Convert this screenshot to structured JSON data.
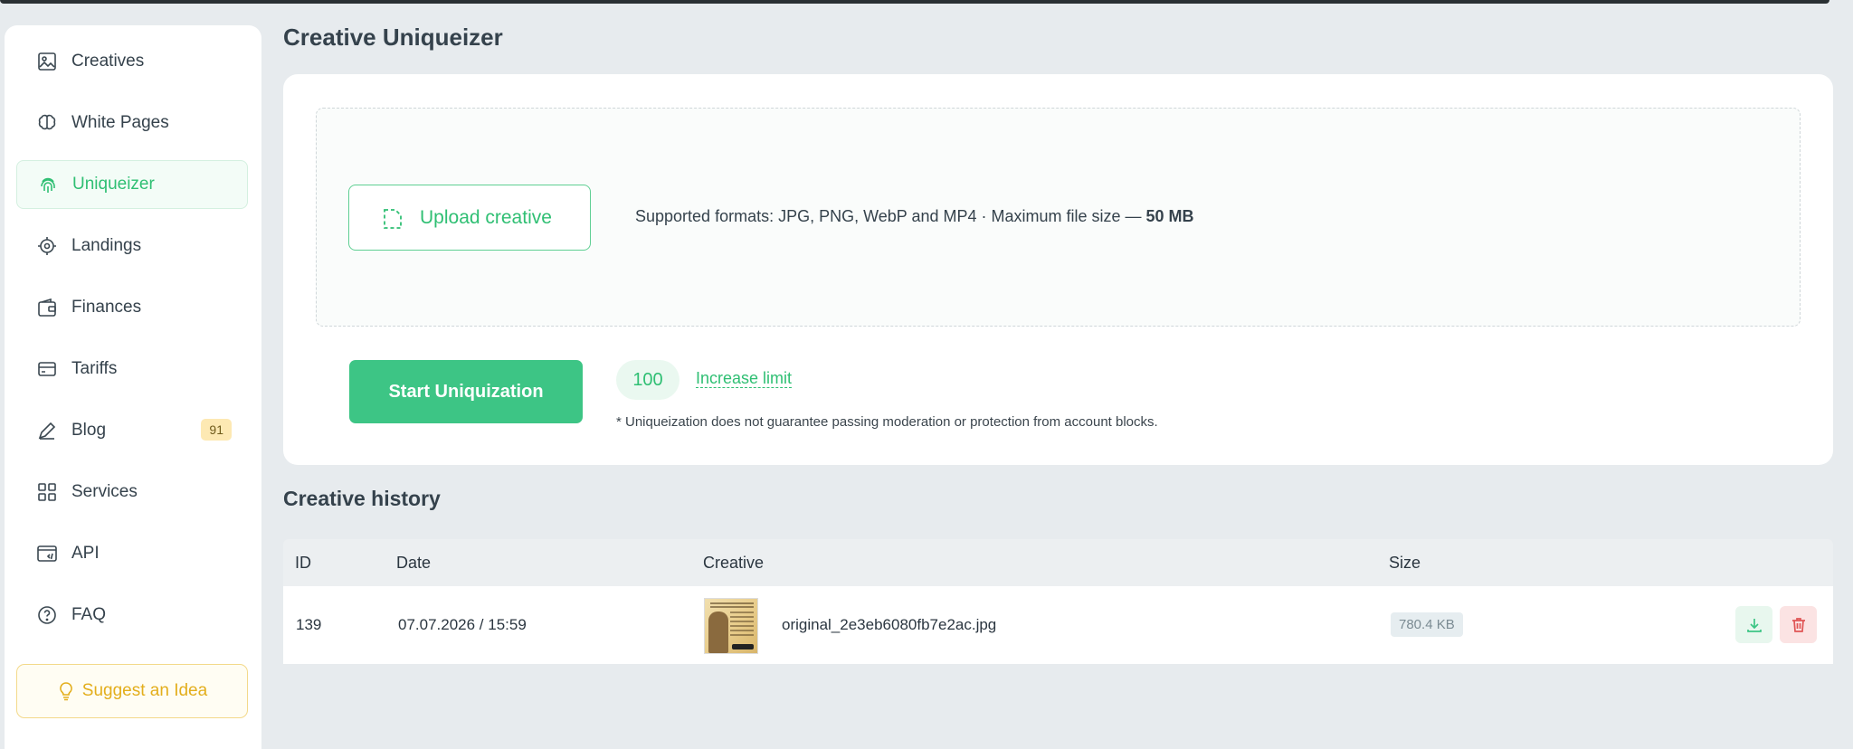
{
  "sidebar": {
    "items": [
      {
        "label": "Creatives",
        "icon": "image-icon"
      },
      {
        "label": "White Pages",
        "icon": "brain-icon"
      },
      {
        "label": "Uniqueizer",
        "icon": "fingerprint-icon"
      },
      {
        "label": "Landings",
        "icon": "target-icon"
      },
      {
        "label": "Finances",
        "icon": "wallet-icon"
      },
      {
        "label": "Tariffs",
        "icon": "card-icon"
      },
      {
        "label": "Blog",
        "icon": "pen-icon",
        "badge": "91"
      },
      {
        "label": "Services",
        "icon": "grid-icon"
      },
      {
        "label": "API",
        "icon": "code-window-icon"
      },
      {
        "label": "FAQ",
        "icon": "question-icon"
      }
    ],
    "active": "Uniqueizer",
    "suggest_label": "Suggest an Idea"
  },
  "page": {
    "title": "Creative Uniqueizer"
  },
  "upload": {
    "button_label": "Upload creative",
    "formats_text": "Supported formats: JPG, PNG, WebP and MP4 · Maximum file size — ",
    "max_size": "50 MB",
    "start_label": "Start Uniquization",
    "limit": "100",
    "increase_label": "Increase limit",
    "disclaimer": "* Uniqueization does not guarantee passing moderation or protection from account blocks."
  },
  "history": {
    "title": "Creative history",
    "columns": [
      "ID",
      "Date",
      "Creative",
      "Size"
    ],
    "rows": [
      {
        "id": "139",
        "date": "07.07.2026 / 15:59",
        "filename": "original_2e3eb6080fb7e2ac.jpg",
        "size": "780.4 KB"
      }
    ]
  },
  "colors": {
    "accent": "#3dc585",
    "background": "#e7ebee",
    "suggest": "#e3ae1c",
    "danger": "#e05555"
  }
}
